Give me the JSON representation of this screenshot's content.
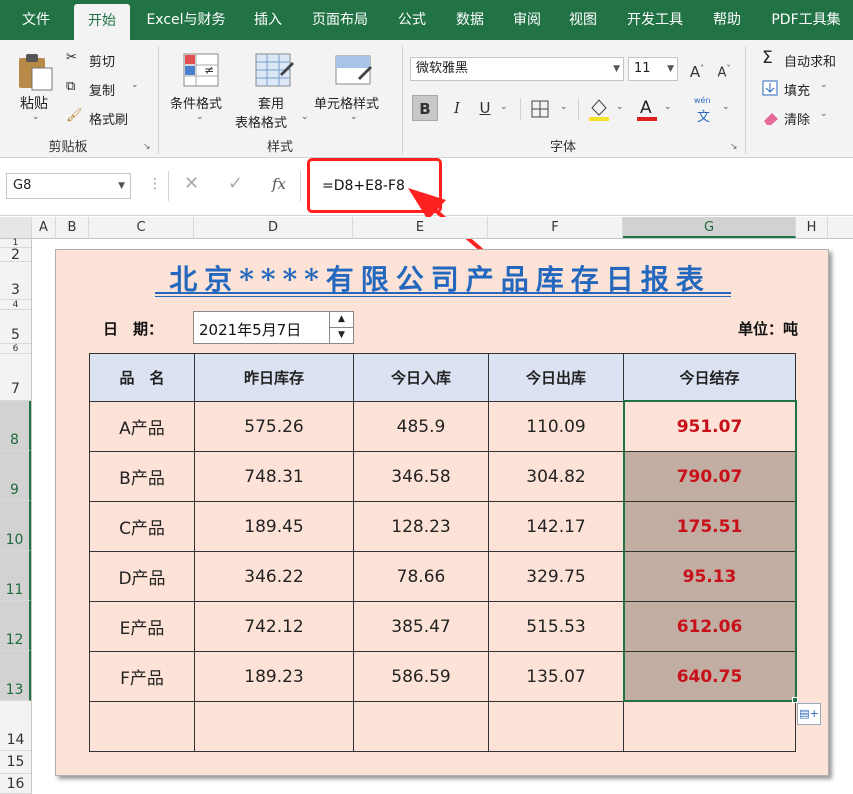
{
  "tabs": [
    "文件",
    "开始",
    "Excel与财务",
    "插入",
    "页面布局",
    "公式",
    "数据",
    "审阅",
    "视图",
    "开发工具",
    "帮助",
    "PDF工具集"
  ],
  "ribbon": {
    "clipboard": {
      "paste": "粘贴",
      "cut": "剪切",
      "copy": "复制",
      "format_painter": "格式刷",
      "group": "剪贴板"
    },
    "styles": {
      "conditional": "条件格式",
      "table_line1": "套用",
      "table_line2": "表格格式",
      "cell_styles": "单元格样式",
      "group": "样式"
    },
    "font": {
      "name": "微软雅黑",
      "size": "11",
      "bold": "B",
      "italic": "I",
      "underline": "U",
      "phonetic_top": "wén",
      "phonetic_char": "文",
      "group": "字体"
    },
    "editing": {
      "autosum": "自动求和",
      "fill": "填充",
      "clear": "清除"
    }
  },
  "formula_bar": {
    "name_box": "G8",
    "formula": "=D8+E8-F8",
    "fx": "fx"
  },
  "columns": [
    "A",
    "B",
    "C",
    "D",
    "E",
    "F",
    "G",
    "H"
  ],
  "rows": [
    "1",
    "2",
    "3",
    "4",
    "5",
    "6",
    "7",
    "8",
    "9",
    "10",
    "11",
    "12",
    "13",
    "14",
    "15",
    "16"
  ],
  "report": {
    "title": "北京****有限公司产品库存日报表",
    "date_label": "日　期：",
    "date_value": "2021年5月7日",
    "unit": "单位：吨",
    "headers": [
      "品　名",
      "昨日库存",
      "今日入库",
      "今日出库",
      "今日结存"
    ],
    "rows": [
      [
        "A产品",
        "575.26",
        "485.9",
        "110.09",
        "951.07"
      ],
      [
        "B产品",
        "748.31",
        "346.58",
        "304.82",
        "790.07"
      ],
      [
        "C产品",
        "189.45",
        "128.23",
        "142.17",
        "175.51"
      ],
      [
        "D产品",
        "346.22",
        "78.66",
        "329.75",
        "95.13"
      ],
      [
        "E产品",
        "742.12",
        "385.47",
        "515.53",
        "612.06"
      ],
      [
        "F产品",
        "189.23",
        "586.59",
        "135.07",
        "640.75"
      ]
    ]
  },
  "colors": {
    "ribbon_green": "#217346",
    "title_blue": "#2468bd",
    "result_red": "#c8101a",
    "highlight_red": "#ff2020"
  }
}
